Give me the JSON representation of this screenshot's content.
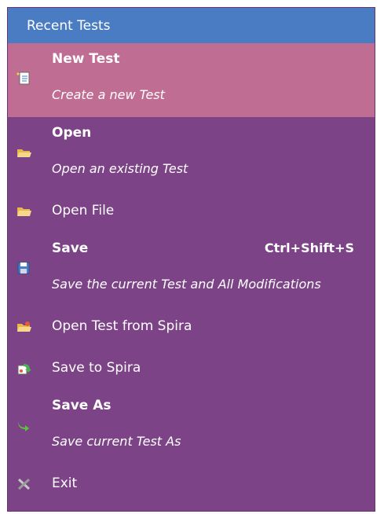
{
  "menu": {
    "header": "Recent Tests",
    "new_test": {
      "title": "New Test",
      "desc": "Create a new Test"
    },
    "open": {
      "title": "Open",
      "desc": "Open an existing Test"
    },
    "open_file": {
      "label": "Open File"
    },
    "save": {
      "title": "Save",
      "shortcut": "Ctrl+Shift+S",
      "desc": "Save the current Test and All Modifications"
    },
    "open_spira": {
      "label": "Open Test from Spira"
    },
    "save_spira": {
      "label": "Save to Spira"
    },
    "save_as": {
      "title": "Save As",
      "desc": "Save current Test As"
    },
    "exit": {
      "label": "Exit"
    }
  },
  "colors": {
    "header_bg": "#4a7cc3",
    "menu_bg": "#7d4387",
    "highlight_bg": "#c06d93"
  },
  "icons": [
    "new-document-icon",
    "folder-open-icon",
    "folder-open-icon",
    "floppy-save-icon",
    "spira-open-icon",
    "spira-save-icon",
    "save-as-arrow-icon",
    "exit-x-icon"
  ]
}
